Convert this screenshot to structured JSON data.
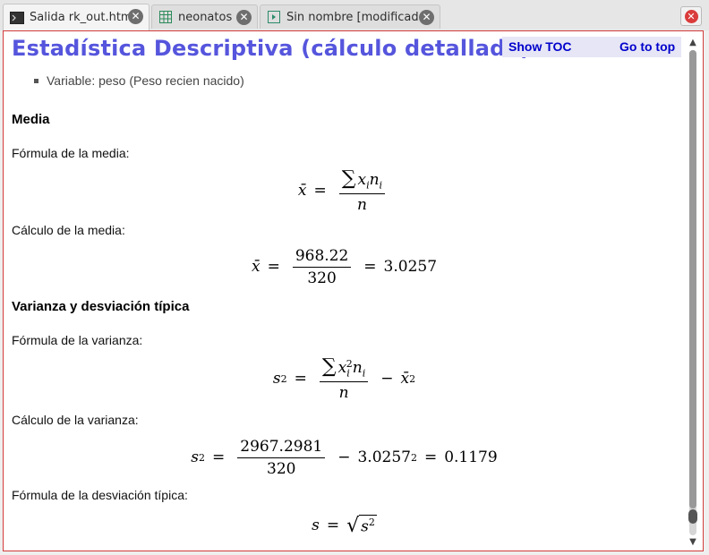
{
  "tabs": [
    {
      "label": "Salida rk_out.html",
      "icon": "terminal-icon",
      "active": true
    },
    {
      "label": "neonatos",
      "icon": "table-icon",
      "active": false
    },
    {
      "label": "Sin nombre [modificado]",
      "icon": "script-icon",
      "active": false
    }
  ],
  "toc": {
    "show": "Show TOC",
    "top": "Go to top"
  },
  "page": {
    "title": "Estadística Descriptiva (cálculo detallado)",
    "variable": "Variable: peso (Peso recien nacido)",
    "sections": {
      "media": "Media",
      "varianza": "Varianza y desviación típica"
    },
    "texts": {
      "formula_media": "Fórmula de la media:",
      "calculo_media": "Cálculo de la media:",
      "formula_varianza": "Fórmula de la varianza:",
      "calculo_varianza": "Cálculo de la varianza:",
      "formula_desviacion": "Fórmula de la desviación típica:"
    },
    "values": {
      "sum_xn": "968.22",
      "n": "320",
      "media": "3.0257",
      "sum_x2n": "2967.2981",
      "media2": "3.0257",
      "varianza": "0.1179"
    }
  },
  "colors": {
    "title": "#5555dd",
    "link": "#0000cc",
    "frame_border": "#d33c3c"
  }
}
